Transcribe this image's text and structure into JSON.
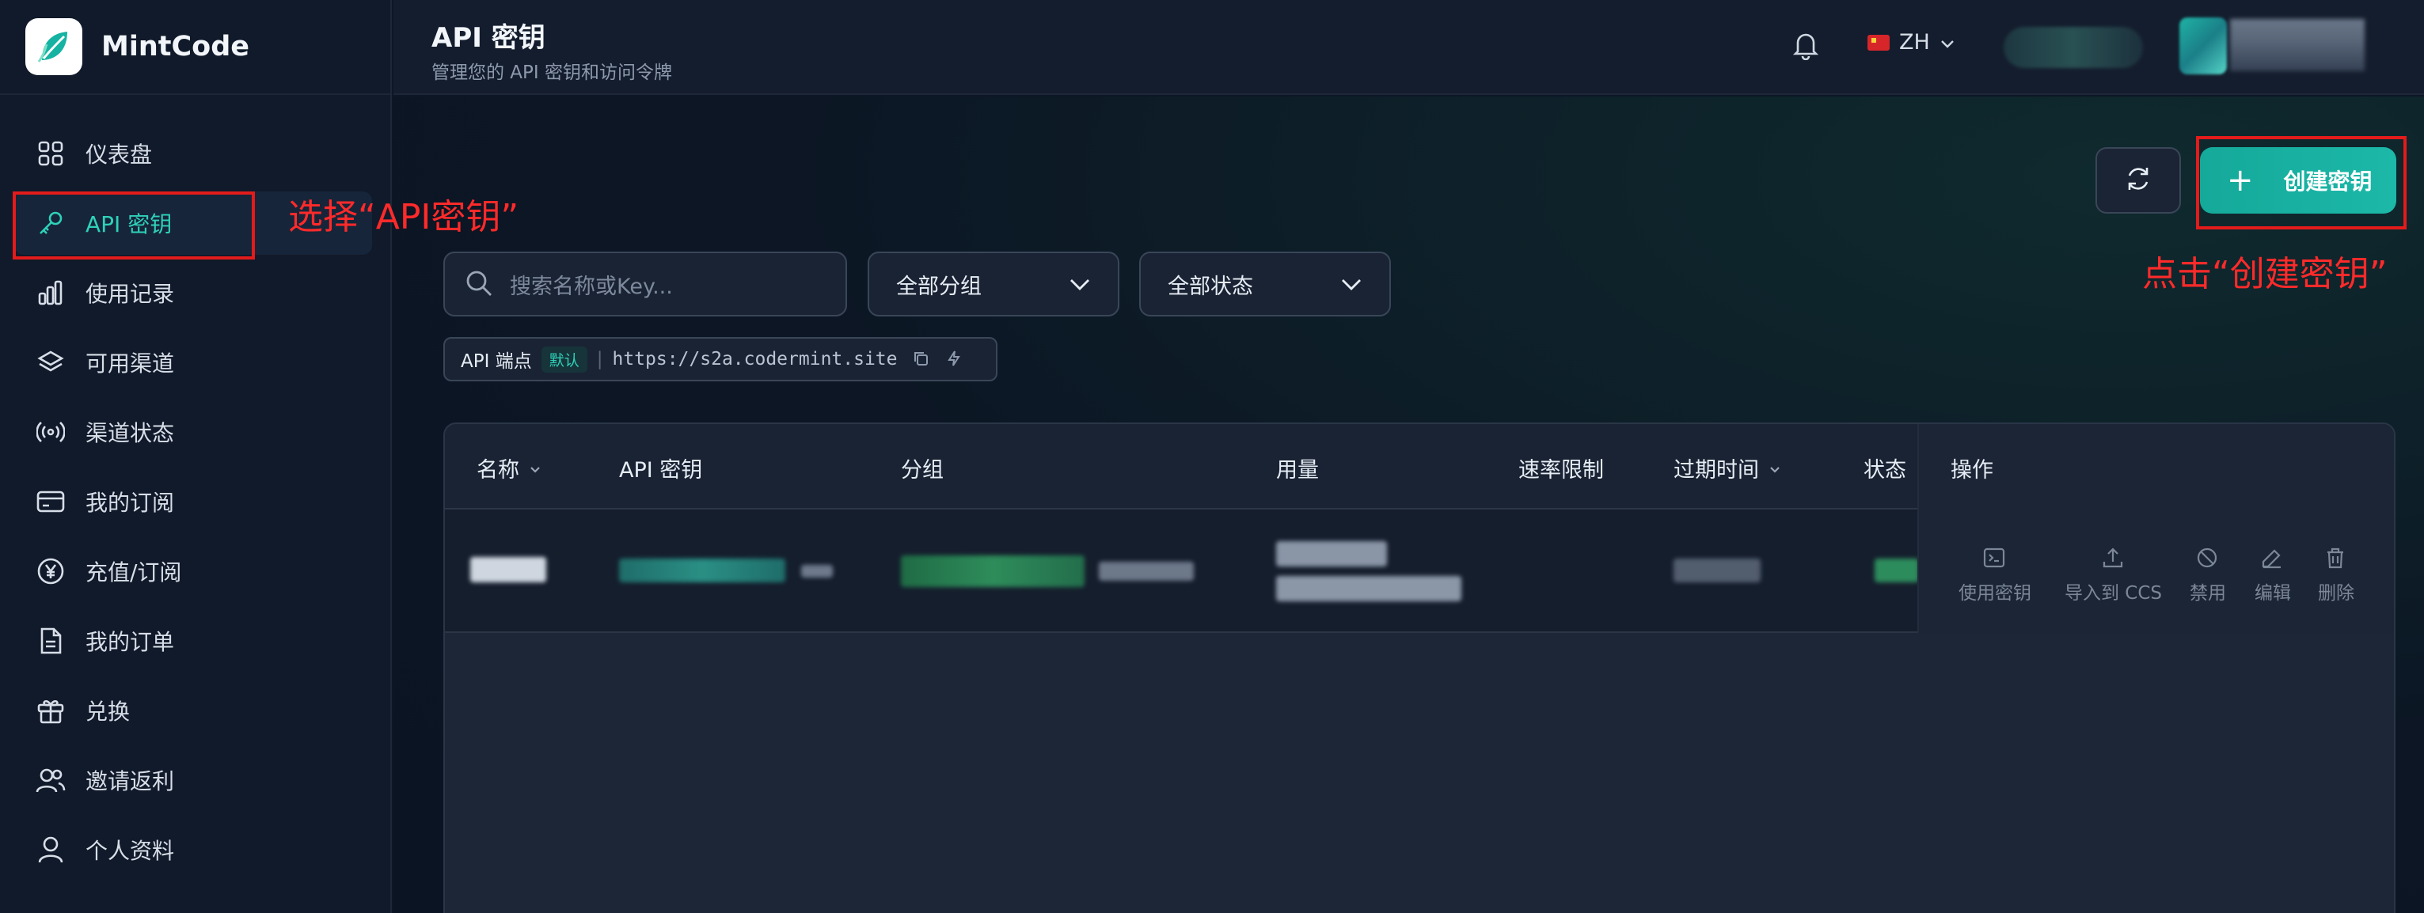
{
  "app": {
    "name": "MintCode"
  },
  "sidebar": {
    "items": [
      {
        "label": "仪表盘",
        "icon": "grid-icon"
      },
      {
        "label": "API 密钥",
        "icon": "key-icon",
        "active": true
      },
      {
        "label": "使用记录",
        "icon": "bar-chart-icon"
      },
      {
        "label": "可用渠道",
        "icon": "layers-icon"
      },
      {
        "label": "渠道状态",
        "icon": "broadcast-icon"
      },
      {
        "label": "我的订阅",
        "icon": "card-icon"
      },
      {
        "label": "充值/订阅",
        "icon": "yen-icon"
      },
      {
        "label": "我的订单",
        "icon": "document-icon"
      },
      {
        "label": "兑换",
        "icon": "gift-icon"
      },
      {
        "label": "邀请返利",
        "icon": "users-icon"
      },
      {
        "label": "个人资料",
        "icon": "user-icon"
      }
    ]
  },
  "header": {
    "title": "API 密钥",
    "subtitle": "管理您的 API 密钥和访问令牌",
    "language": "ZH"
  },
  "toolbar": {
    "create_label": "创建密钥",
    "search_placeholder": "搜索名称或Key...",
    "group_filter": "全部分组",
    "status_filter": "全部状态"
  },
  "endpoint": {
    "label": "API 端点",
    "badge": "默认",
    "url": "https://s2a.codermint.site"
  },
  "table": {
    "columns": [
      "名称",
      "API 密钥",
      "分组",
      "用量",
      "速率限制",
      "过期时间",
      "状态",
      "操作"
    ],
    "actions": [
      "使用密钥",
      "导入到 CCS",
      "禁用",
      "编辑",
      "删除"
    ]
  },
  "annotations": {
    "select_hint": "选择“API密钥”",
    "click_hint": "点击“创建密钥”"
  },
  "colors": {
    "accent": "#2fd1b8",
    "annotation": "#e31b1b"
  }
}
